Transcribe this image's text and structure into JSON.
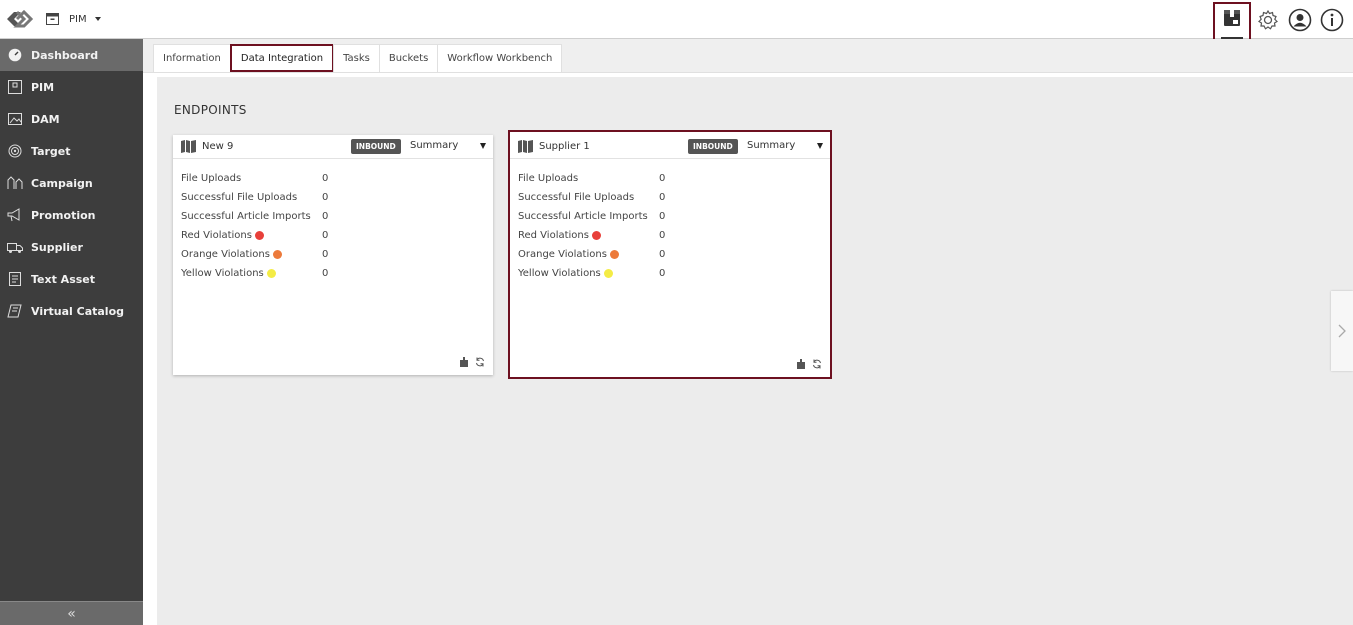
{
  "header": {
    "module_label": "PIM"
  },
  "sidebar": {
    "items": [
      {
        "label": "Dashboard",
        "icon": "dashboard-icon"
      },
      {
        "label": "PIM",
        "icon": "pim-icon"
      },
      {
        "label": "DAM",
        "icon": "image-icon"
      },
      {
        "label": "Target",
        "icon": "target-icon"
      },
      {
        "label": "Campaign",
        "icon": "campaign-icon"
      },
      {
        "label": "Promotion",
        "icon": "megaphone-icon"
      },
      {
        "label": "Supplier",
        "icon": "truck-icon"
      },
      {
        "label": "Text Asset",
        "icon": "document-icon"
      },
      {
        "label": "Virtual Catalog",
        "icon": "catalog-icon"
      }
    ],
    "collapse_glyph": "«"
  },
  "tabs": [
    {
      "label": "Information"
    },
    {
      "label": "Data Integration"
    },
    {
      "label": "Tasks"
    },
    {
      "label": "Buckets"
    },
    {
      "label": "Workflow Workbench"
    }
  ],
  "main": {
    "section_title": "ENDPOINTS",
    "endpoints": [
      {
        "name": "New 9",
        "direction": "INBOUND",
        "view": "Summary",
        "rows": [
          {
            "label": "File Uploads",
            "value": "0"
          },
          {
            "label": "Successful File Uploads",
            "value": "0"
          },
          {
            "label": "Successful Article Imports",
            "value": "0"
          },
          {
            "label": "Red Violations",
            "value": "0"
          },
          {
            "label": "Orange Violations",
            "value": "0"
          },
          {
            "label": "Yellow Violations",
            "value": "0"
          }
        ]
      },
      {
        "name": "Supplier 1",
        "direction": "INBOUND",
        "view": "Summary",
        "rows": [
          {
            "label": "File Uploads",
            "value": "0"
          },
          {
            "label": "Successful File Uploads",
            "value": "0"
          },
          {
            "label": "Successful Article Imports",
            "value": "0"
          },
          {
            "label": "Red Violations",
            "value": "0"
          },
          {
            "label": "Orange Violations",
            "value": "0"
          },
          {
            "label": "Yellow Violations",
            "value": "0"
          }
        ]
      }
    ]
  },
  "colors": {
    "highlight": "#6d1020",
    "red": "#e8403a",
    "orange": "#ec7a3b",
    "yellow": "#f4ec45",
    "sidebar_bg": "#3d3d3d"
  }
}
